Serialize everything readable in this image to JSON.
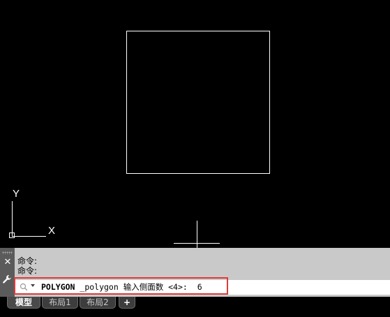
{
  "canvas": {
    "background": "#000000",
    "ucs_y_label": "Y",
    "ucs_x_label": "X",
    "shape_color": "#ffffff"
  },
  "command_panel": {
    "history": [
      "命令:",
      "命令:"
    ],
    "input": {
      "command": "POLYGON",
      "prompt": " _polygon 输入侧面数 <4>:",
      "value": "6"
    },
    "highlight_color": "#e03a3a"
  },
  "tabs": [
    {
      "label": "模型",
      "active": true
    },
    {
      "label": "布局1",
      "active": false
    },
    {
      "label": "布局2",
      "active": false
    },
    {
      "label": "+",
      "active": false
    }
  ]
}
